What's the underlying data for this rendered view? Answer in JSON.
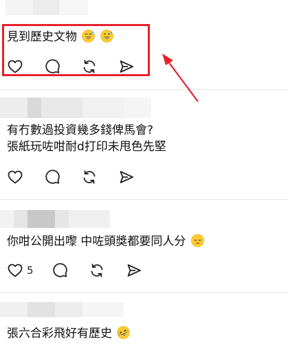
{
  "comments": [
    {
      "lines": [
        "見到歷史文物"
      ],
      "emojis": [
        "grinning-sweat-emoji",
        "grinning-sweat-emoji"
      ],
      "like_count": ""
    },
    {
      "lines": [
        "有冇數過投資幾多錢俾馬會?",
        "張紙玩咗咁耐d打印未甩色先堅"
      ],
      "emojis": [],
      "like_count": ""
    },
    {
      "lines": [
        "你咁公開出嚟 中咗頭獎都要同人分"
      ],
      "emojis": [
        "pensive-emoji"
      ],
      "like_count": "5"
    },
    {
      "lines": [
        "張六合彩飛好有歷史"
      ],
      "emojis": [
        "rofl-emoji"
      ],
      "like_count": ""
    }
  ],
  "icons": {
    "like": "heart-icon",
    "reply": "speech-bubble-icon",
    "repost": "repost-icon",
    "share": "send-icon"
  },
  "colors": {
    "highlight": "#e8202a",
    "text": "#111111",
    "divider": "#e4e4e4",
    "emoji_yellow": "#ffcc33"
  }
}
